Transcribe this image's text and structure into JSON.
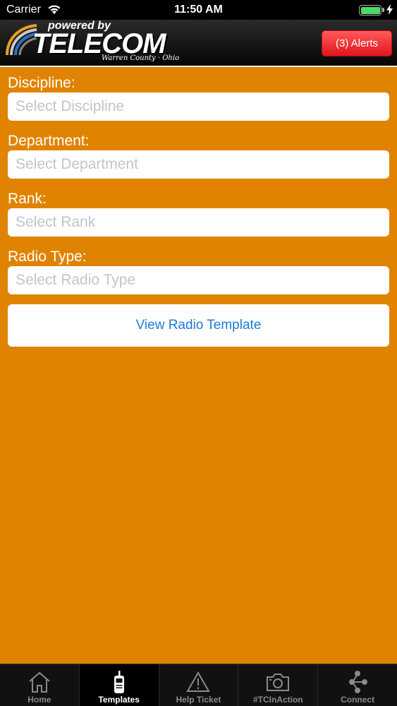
{
  "status_bar": {
    "carrier": "Carrier",
    "time": "11:50 AM",
    "battery_level": 1.0
  },
  "header": {
    "logo_powered_by": "powered by",
    "logo_brand": "TELECOM",
    "logo_county": "Warren County · Ohio",
    "alerts_label": "(3) Alerts"
  },
  "form": {
    "discipline_label": "Discipline:",
    "discipline_placeholder": "Select Discipline",
    "department_label": "Department:",
    "department_placeholder": "Select Department",
    "rank_label": "Rank:",
    "rank_placeholder": "Select Rank",
    "radio_type_label": "Radio Type:",
    "radio_type_placeholder": "Select Radio Type",
    "view_button_label": "View Radio Template"
  },
  "tabs": [
    {
      "label": "Home",
      "icon": "home-icon",
      "active": false
    },
    {
      "label": "Templates",
      "icon": "radio-icon",
      "active": true
    },
    {
      "label": "Help Ticket",
      "icon": "warning-icon",
      "active": false
    },
    {
      "label": "#TCInAction",
      "icon": "camera-icon",
      "active": false
    },
    {
      "label": "Connect",
      "icon": "share-icon",
      "active": false
    }
  ],
  "colors": {
    "background": "#e08300",
    "alert_red": "#e0161c",
    "link_blue": "#1d7bd6"
  }
}
